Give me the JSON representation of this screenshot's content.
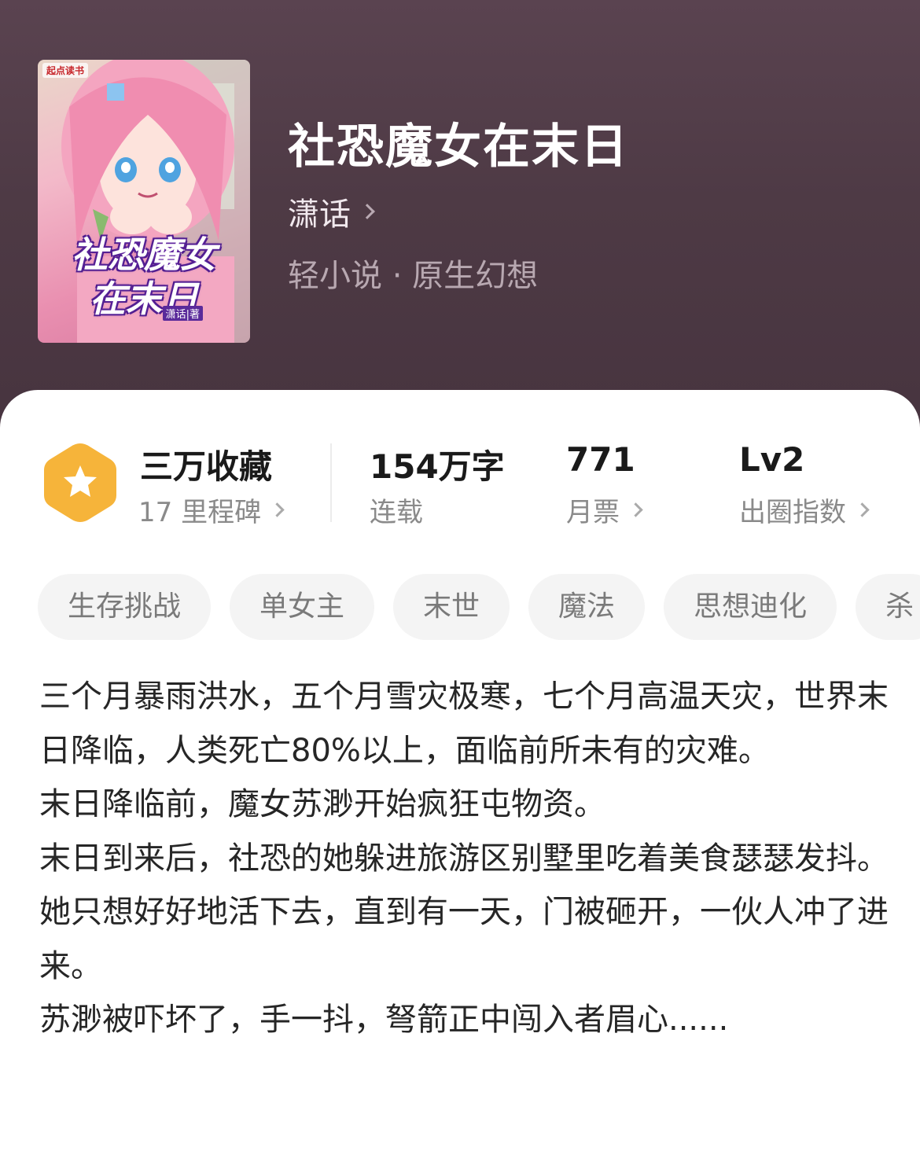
{
  "book": {
    "title": "社恐魔女在末日",
    "author": "潇话",
    "category": "轻小说 · 原生幻想",
    "cover": {
      "brand": "起点读书",
      "title_line1": "社恐魔女",
      "title_line2": "在末日",
      "author_mark": "潇话|著"
    }
  },
  "stats": {
    "collections": {
      "value": "三万收藏",
      "sub": "17 里程碑"
    },
    "words": {
      "value": "154万字",
      "sub": "连载"
    },
    "monthly_tickets": {
      "value": "771",
      "sub": "月票"
    },
    "popularity": {
      "value": "Lv2",
      "sub": "出圈指数"
    }
  },
  "tags": [
    "生存挑战",
    "单女主",
    "末世",
    "魔法",
    "思想迪化",
    "杀"
  ],
  "synopsis": [
    "三个月暴雨洪水，五个月雪灾极寒，七个月高温天灾，世界末日降临，人类死亡80%以上，面临前所未有的灾难。",
    "末日降临前，魔女苏渺开始疯狂屯物资。",
    "末日到来后，社恐的她躲进旅游区别墅里吃着美食瑟瑟发抖。",
    "她只想好好地活下去，直到有一天，门被砸开，一伙人冲了进来。",
    "苏渺被吓坏了，手一抖，弩箭正中闯入者眉心......"
  ],
  "colors": {
    "header_bg": "#4e3a45",
    "badge": "#f6b43a",
    "tag_bg": "#f4f4f4"
  },
  "icons": {
    "collection_badge": "star-hexagon-icon",
    "chevron": "chevron-right-icon"
  }
}
